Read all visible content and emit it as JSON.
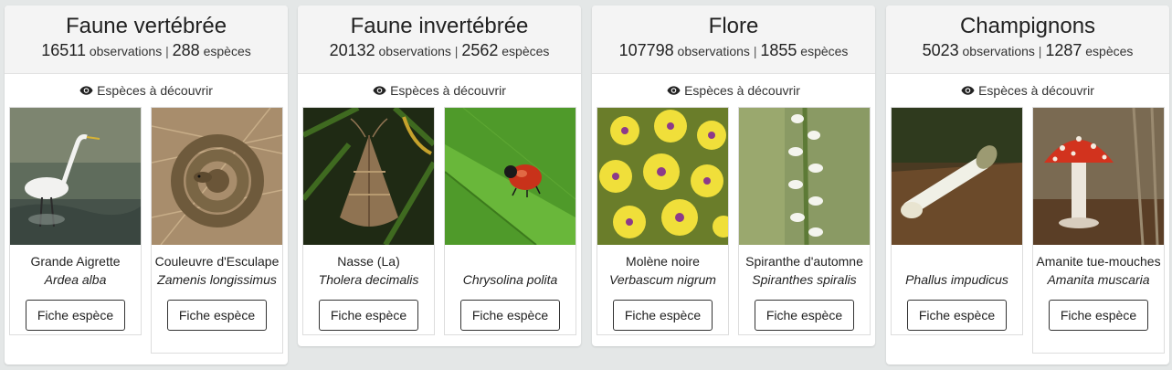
{
  "groups": [
    {
      "title": "Faune vertébrée",
      "observations": "16511",
      "obs_label": "observations",
      "species": "288",
      "species_label": "espèces",
      "discover": "Espèces à découvrir",
      "cards": [
        {
          "common": "Grande Aigrette",
          "sci": "Ardea alba",
          "button": "Fiche espèce",
          "photo": "great-egret-photo"
        },
        {
          "common": "Couleuvre d'Esculape",
          "sci": "Zamenis longissimus",
          "button": "Fiche espèce",
          "photo": "aesculapian-snake-photo"
        }
      ]
    },
    {
      "title": "Faune invertébrée",
      "observations": "20132",
      "obs_label": "observations",
      "species": "2562",
      "species_label": "espèces",
      "discover": "Espèces à découvrir",
      "cards": [
        {
          "common": "Nasse (La)",
          "sci": "Tholera decimalis",
          "button": "Fiche espèce",
          "photo": "moth-photo"
        },
        {
          "common": "",
          "sci": "Chrysolina polita",
          "button": "Fiche espèce",
          "photo": "leaf-beetle-photo"
        }
      ]
    },
    {
      "title": "Flore",
      "observations": "107798",
      "obs_label": "observations",
      "species": "1855",
      "species_label": "espèces",
      "discover": "Espèces à découvrir",
      "cards": [
        {
          "common": "Molène noire",
          "sci": "Verbascum nigrum",
          "button": "Fiche espèce",
          "photo": "mullein-photo"
        },
        {
          "common": "Spiranthe d'automne",
          "sci": "Spiranthes spiralis",
          "button": "Fiche espèce",
          "photo": "orchid-photo"
        }
      ]
    },
    {
      "title": "Champignons",
      "observations": "5023",
      "obs_label": "observations",
      "species": "1287",
      "species_label": "espèces",
      "discover": "Espèces à découvrir",
      "cards": [
        {
          "common": "",
          "sci": "Phallus impudicus",
          "button": "Fiche espèce",
          "photo": "stinkhorn-photo"
        },
        {
          "common": "Amanite tue-mouches",
          "sci": "Amanita muscaria",
          "button": "Fiche espèce",
          "photo": "fly-agaric-photo"
        }
      ]
    }
  ]
}
